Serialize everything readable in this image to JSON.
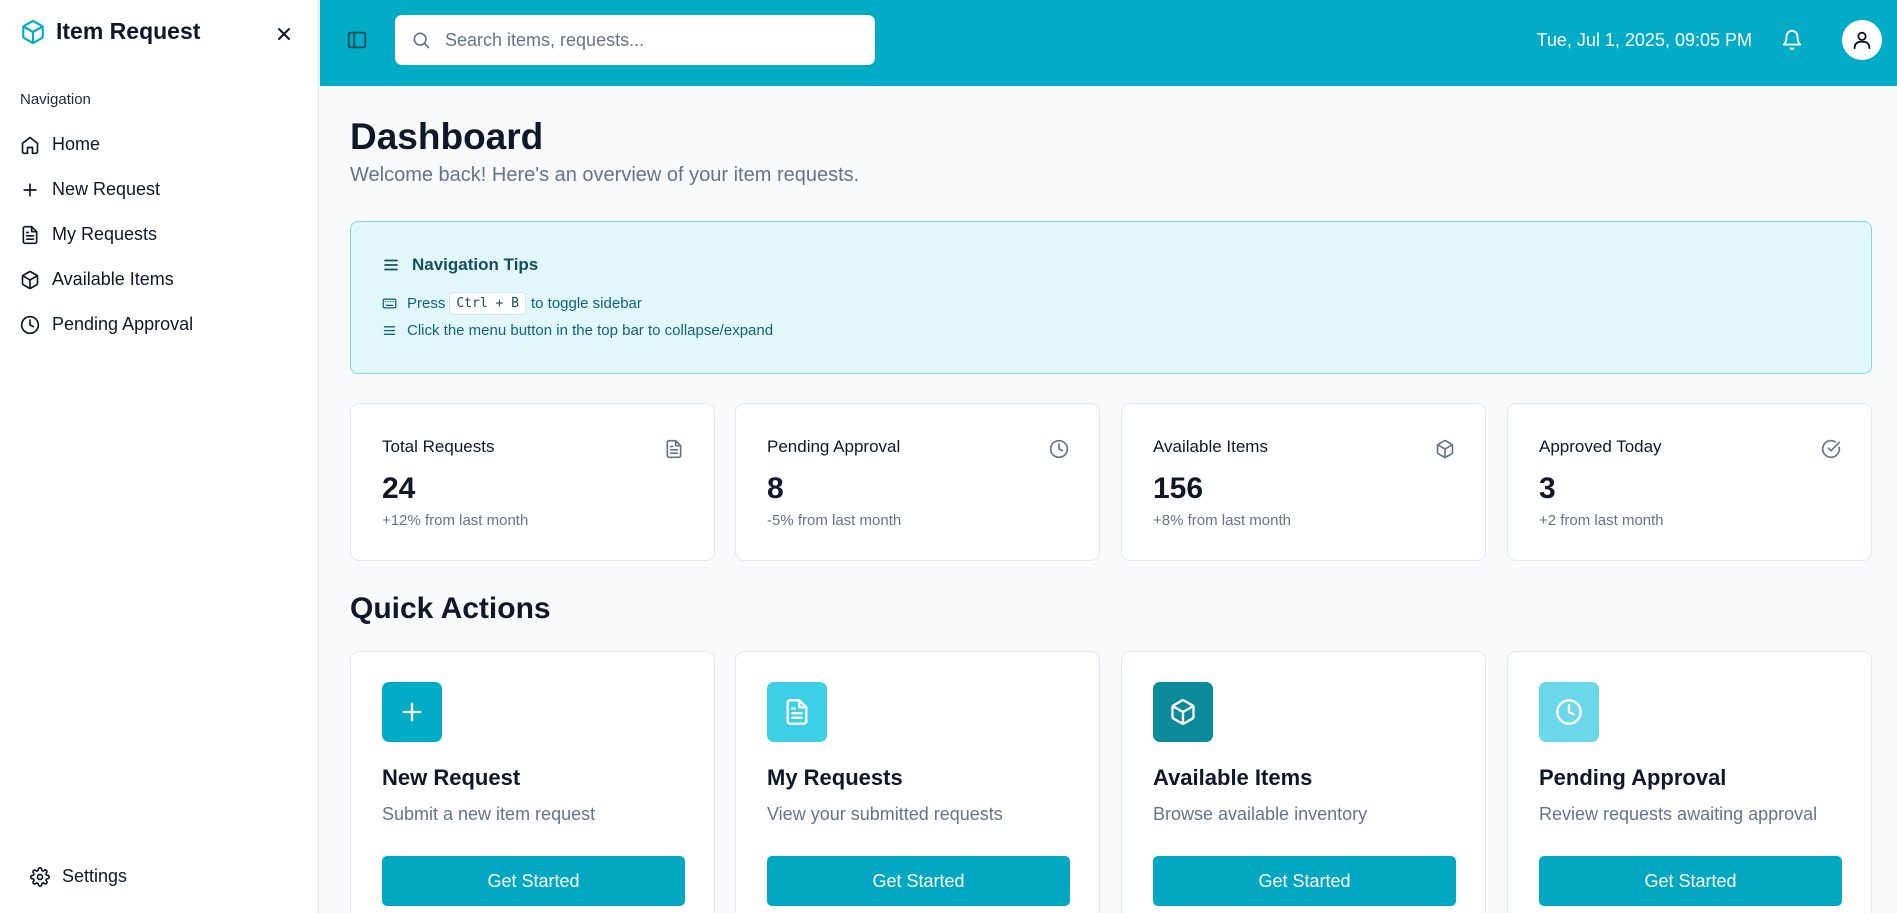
{
  "colors": {
    "accent": "#02acc6",
    "quick_action_icons": [
      "#02acc6",
      "#3ccfe6",
      "#0b8a9c",
      "#6ad7eb"
    ]
  },
  "sidebar": {
    "brand_title": "Item Request",
    "brand_icon": "cube-icon",
    "nav_label": "Navigation",
    "items": [
      {
        "label": "Home",
        "icon": "home-icon"
      },
      {
        "label": "New Request",
        "icon": "plus-icon"
      },
      {
        "label": "My Requests",
        "icon": "file-text-icon"
      },
      {
        "label": "Available Items",
        "icon": "cube-icon"
      },
      {
        "label": "Pending Approval",
        "icon": "clock-icon"
      }
    ],
    "settings_label": "Settings"
  },
  "topbar": {
    "search_placeholder": "Search items, requests...",
    "datetime": "Tue, Jul 1, 2025, 09:05 PM"
  },
  "main": {
    "title": "Dashboard",
    "subtitle": "Welcome back! Here's an overview of your item requests.",
    "tips": {
      "title": "Navigation Tips",
      "press": "Press",
      "shortcut": "Ctrl + B",
      "toggle_text": "to toggle sidebar",
      "menu_text": "Click the menu button in the top bar to collapse/expand"
    },
    "stats": [
      {
        "label": "Total Requests",
        "value": "24",
        "change": "+12% from last month",
        "icon": "file-text-icon"
      },
      {
        "label": "Pending Approval",
        "value": "8",
        "change": "-5% from last month",
        "icon": "clock-icon"
      },
      {
        "label": "Available Items",
        "value": "156",
        "change": "+8% from last month",
        "icon": "cube-icon"
      },
      {
        "label": "Approved Today",
        "value": "3",
        "change": "+2 from last month",
        "icon": "check-circle-icon"
      }
    ],
    "quick_actions_title": "Quick Actions",
    "quick_actions": [
      {
        "title": "New Request",
        "desc": "Submit a new item request",
        "button": "Get Started",
        "icon": "plus-icon"
      },
      {
        "title": "My Requests",
        "desc": "View your submitted requests",
        "button": "Get Started",
        "icon": "file-text-icon"
      },
      {
        "title": "Available Items",
        "desc": "Browse available inventory",
        "button": "Get Started",
        "icon": "cube-icon"
      },
      {
        "title": "Pending Approval",
        "desc": "Review requests awaiting approval",
        "button": "Get Started",
        "icon": "clock-icon"
      }
    ]
  }
}
